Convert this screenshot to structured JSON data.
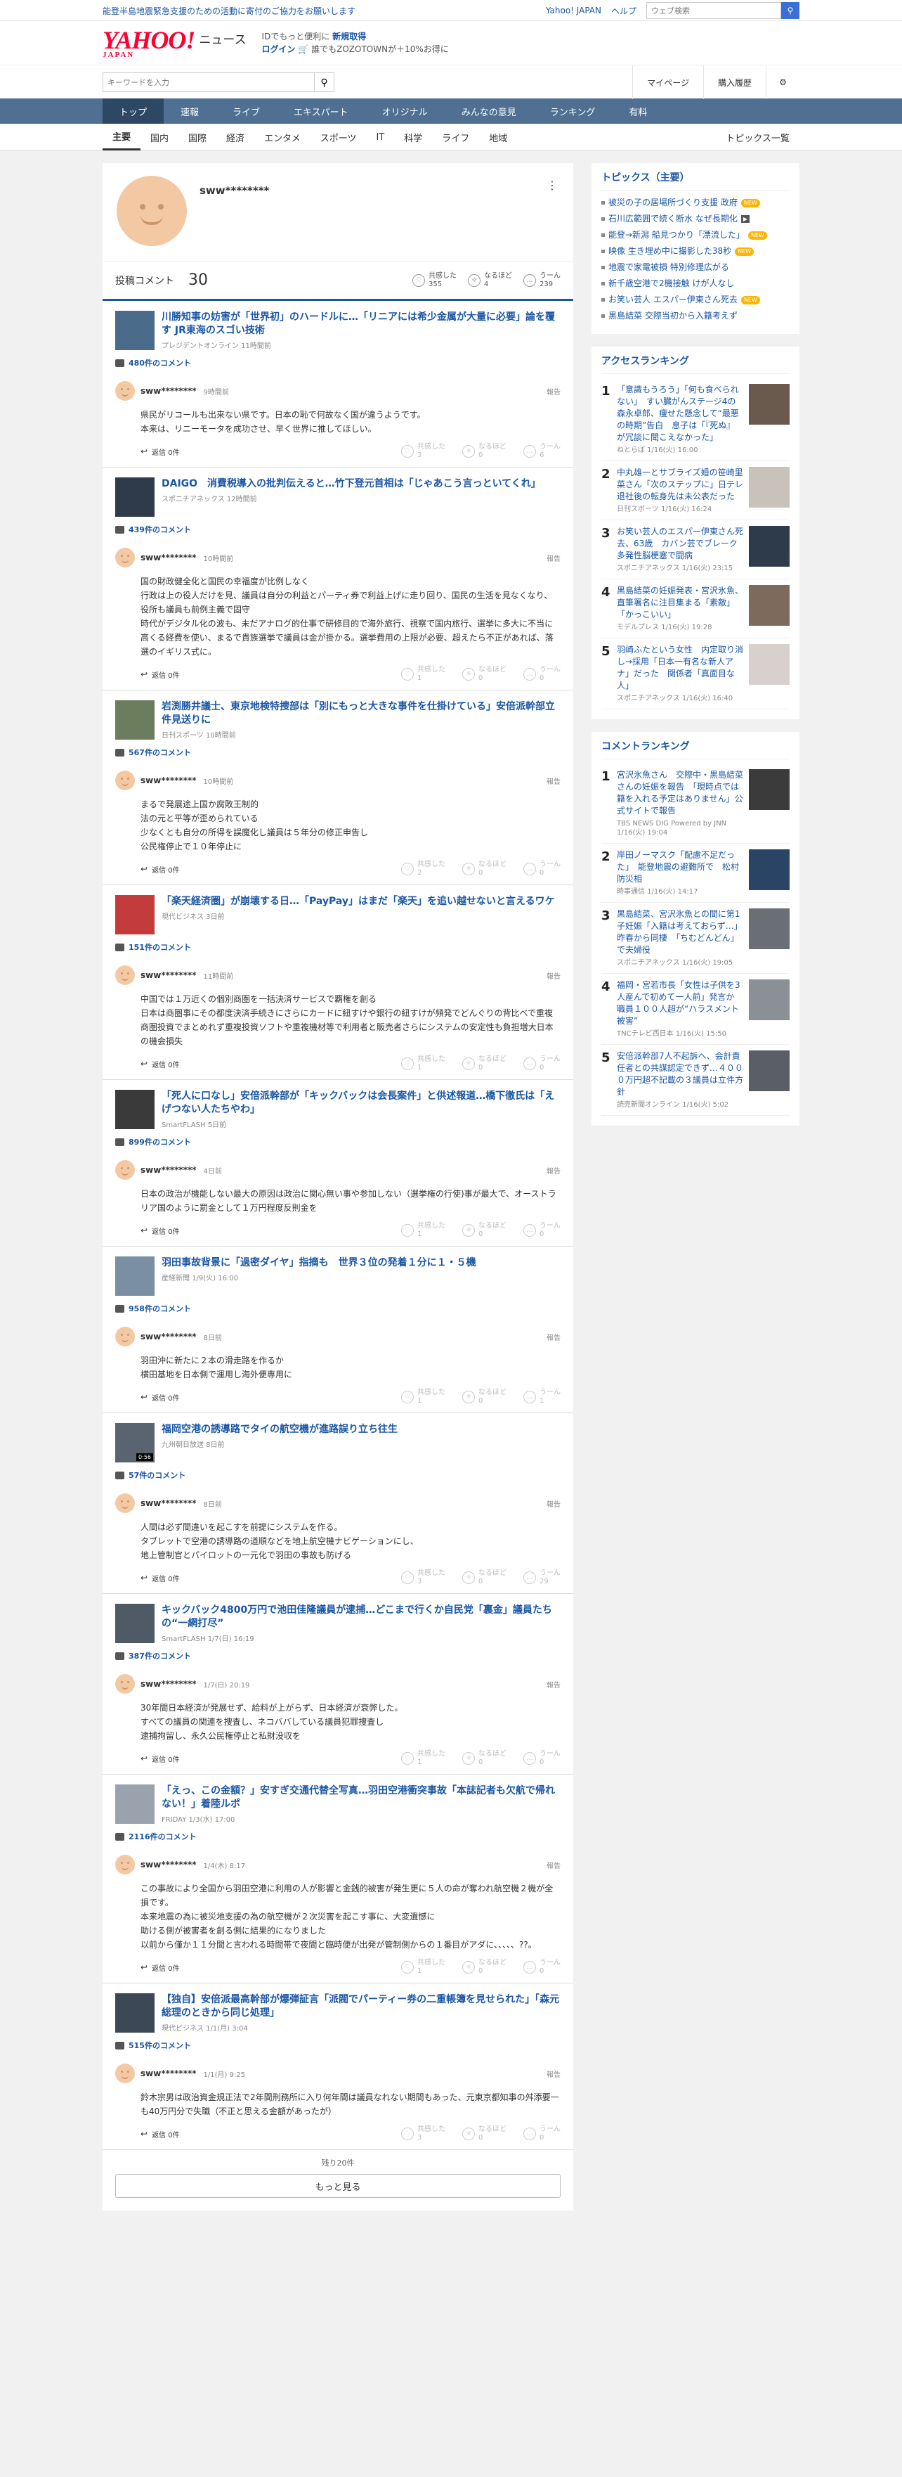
{
  "notice": "能登半島地震緊急支援のための活動に寄付のご協力をお願いします",
  "toplinks": {
    "yahoo": "Yahoo! JAPAN",
    "help": "ヘルプ",
    "web_search_placeholder": "ウェブ検索"
  },
  "brand": {
    "logo": "YAHOO!",
    "logo_sub": "JAPAN",
    "service": "ニュース",
    "promo_line1_a": "IDでもっと便利に",
    "promo_line1_b": "新規取得",
    "promo_line2_a": "ログイン",
    "promo_line2_b": "誰でもZOZOTOWNが＋10%お得に"
  },
  "search": {
    "placeholder": "キーワードを入力",
    "mypage": "マイページ",
    "history": "購入履歴"
  },
  "gnav": [
    "トップ",
    "速報",
    "ライブ",
    "エキスパート",
    "オリジナル",
    "みんなの意見",
    "ランキング",
    "有料"
  ],
  "subnav": [
    "主要",
    "国内",
    "国際",
    "経済",
    "エンタメ",
    "スポーツ",
    "IT",
    "科学",
    "ライフ",
    "地域"
  ],
  "subnav_topics": "トピックス一覧",
  "profile": {
    "username": "sww********",
    "posts_label": "投稿コメント",
    "posts_count": "30",
    "r1_label": "共感した",
    "r1_val": "355",
    "r2_label": "なるほど",
    "r2_val": "4",
    "r3_label": "うーん",
    "r3_val": "239"
  },
  "ui": {
    "reply": "返信 0件",
    "report": "報告",
    "empathy": "共感した",
    "naruhodo": "なるほど",
    "uun": "うーん",
    "remaining": "残り20件",
    "more": "もっと見る"
  },
  "items": [
    {
      "title": "川勝知事の妨害が「世界初」のハードルに…「リニアには希少金属が大量に必要」論を覆す JR東海のスゴい技術",
      "src": "プレジデントオンライン 11時間前",
      "count": "480件のコメント",
      "time": "9時間前",
      "text": "県民がリコールも出来ない県です。日本の恥で何故なく国が違うようです。\n本来は、リニーモータを成功させ、早く世界に推してほしい。",
      "r1": "3",
      "r2": "0",
      "r3": "6"
    },
    {
      "title": "DAIGO　消費税導入の批判伝えると…竹下登元首相は「じゃあこう言っといてくれ」",
      "src": "スポニチアネックス 12時間前",
      "count": "439件のコメント",
      "time": "10時間前",
      "text": "国の財政健全化と国民の幸福度が比例しなく\n行政は上の役人だけを見、議員は自分の利益とパーティ券で利益上げに走り回り、国民の生活を見なくなり、役所も議員も前例主義で固守\n時代がデジタル化の波も、未だアナログ的仕事で研修目的で海外旅行、視察で国内旅行、選挙に多大に不当に高くる経費を使い、まるで貴族選挙で議員は金が掛かる。選挙費用の上限が必要、超えたら不正があれば、落選のイギリス式に。",
      "r1": "1",
      "r2": "0",
      "r3": "0"
    },
    {
      "title": "岩渕勝井議士、東京地検特捜部は「別にもっと大きな事件を仕掛けている」安倍派幹部立件見送りに",
      "src": "日刊スポーツ 10時間前",
      "count": "567件のコメント",
      "time": "10時間前",
      "text": "まるで発展途上国か腐敗王制的\n法の元と平等が歪められている\n少なくとも自分の所得を誤魔化し議員は５年分の修正申告し\n公民権停止で１０年停止に",
      "r1": "2",
      "r2": "0",
      "r3": "0"
    },
    {
      "title": "「楽天経済圏」が崩壊する日…「PayPay」はまだ「楽天」を追い越せないと言えるワケ",
      "src": "現代ビジネス 3日前",
      "count": "151件のコメント",
      "time": "11時間前",
      "text": "中国では１万近くの個別商圏を一括決済サービスで覇権を創る\n日本は商圏事にその都度決済手続きにさらにカードに紐すけや銀行の紐すけが頻発でどんぐりの背比べで重複商圏投資でまとめれず重複投資ソフトや重複機材等で利用者と販売者さらにシステムの安定性も負担増大日本の機会損失",
      "r1": "1",
      "r2": "0",
      "r3": "0"
    },
    {
      "title": "「死人に口なし」安倍派幹部が「キックバックは会長案件」と供述報道…橋下徹氏は「えげつない人たちやわ」",
      "src": "SmartFLASH 5日前",
      "count": "899件のコメント",
      "time": "4日前",
      "text": "日本の政治が機能しない最大の原因は政治に関心無い事や参加しない（選挙権の行使)事が最大で、オーストラリア国のように罰金として１万円程度反則金を",
      "r1": "1",
      "r2": "0",
      "r3": "0"
    },
    {
      "title": "羽田事故背景に「過密ダイヤ」指摘も　世界３位の発着１分に１・５機",
      "src": "産経新聞 1/9(火) 16:00",
      "count": "958件のコメント",
      "time": "8日前",
      "text": "羽田沖に新たに２本の滑走路を作るか\n横田基地を日本側で運用し海外便専用に",
      "r1": "1",
      "r2": "0",
      "r3": "1"
    },
    {
      "title": "福岡空港の誘導路でタイの航空機が進路誤り立ち往生",
      "src": "九州朝日放送 8日前",
      "count": "57件のコメント",
      "time": "8日前",
      "video": "0:56",
      "text": "人間は必ず間違いを起こすを前提にシステムを作る。\nタブレットで空港の誘導路の道順などを地上航空機ナビゲーションにし、\n地上管制官とパイロットの一元化で羽田の事故も防げる",
      "r1": "3",
      "r2": "0",
      "r3": "29"
    },
    {
      "title": "キックバック4800万円で池田佳隆議員が逮捕…どこまで行くか自民党「裏金」議員たちの“一網打尽”",
      "src": "SmartFLASH 1/7(日) 16:19",
      "count": "387件のコメント",
      "time": "1/7(日) 20:19",
      "text": "30年間日本経済が発展せず、給料が上がらず、日本経済が衰弊した。\nすべての議員の関連を捜査し、ネコババしている議員犯罪捜査し\n逮捕拘留し、永久公民権停止と私財没収を",
      "r1": "1",
      "r2": "0",
      "r3": "0"
    },
    {
      "title": "「えっ、この金額？」安すぎ交通代替全写真…羽田空港衝突事故「本誌記者も欠航で帰れない！」着陸ルポ",
      "src": "FRIDAY 1/3(水) 17:00",
      "count": "2116件のコメント",
      "time": "1/4(木) 8:17",
      "text": "この事故により全国から羽田空港に利用の人が影響と金銭的被害が発生更に５人の命が奪われ航空機２機が全損です。\n本来地震の為に被災地支援の為の航空機が２次災害を起こす事に、大変遺憾に\n助ける側が被害者を創る側に結果的になりました\n以前から僅か１１分間と言われる時間帯で夜間と臨時便が出発が管制側からの１番目がアダに、、、、、??。",
      "r1": "1",
      "r2": "0",
      "r3": "0"
    },
    {
      "title": "【独自】安倍派最高幹部が爆弾証言「派閥でパーティー券の二重帳簿を見せられた」「森元総理のときから同じ処理」",
      "src": "現代ビジネス 1/1(月) 3:04",
      "count": "515件のコメント",
      "time": "1/1(月) 9:25",
      "text": "鈴木宗男は政治資金規正法で2年間刑務所に入り何年間は議員なれない期間もあった、元東京都知事の舛添要一も40万円分で失職（不正と思える金額があったが）",
      "r1": "3",
      "r2": "0",
      "r3": "0"
    }
  ],
  "topics": {
    "title": "トピックス（主要）",
    "items": [
      {
        "t": "被災の子の居場所づくり支援 政府",
        "b": "NEW"
      },
      {
        "t": "石川広範囲で続く断水 なぜ長期化",
        "b": "▶"
      },
      {
        "t": "能登→新潟 船見つかり「漂流した」",
        "b": "NEW"
      },
      {
        "t": "映像 生き埋め中に撮影した38秒",
        "b": "NEW"
      },
      {
        "t": "地震で家電被損 特別修理広がる",
        "b": ""
      },
      {
        "t": "新千歳空港で2機接触 けが人なし",
        "b": ""
      },
      {
        "t": "お笑い芸人 エスパー伊東さん死去",
        "b": "NEW"
      },
      {
        "t": "黒島結菜 交際当初から入籍考えず",
        "b": ""
      }
    ]
  },
  "access": {
    "title": "アクセスランキング",
    "items": [
      {
        "n": "1",
        "t": "「意識もうろう」「何も食べられない」　すい臓がんステージ4の森永卓郎、痩せた懸念して“最悪の時期”告白　息子は「『死ぬ』が冗談に聞こえなかった」",
        "s": "ねとらぼ 1/16(火) 16:00"
      },
      {
        "n": "2",
        "t": "中丸雄一とサブライズ婚の笹崎里菜さん「次のステップに」日テレ退社後の転身先は未公表だった",
        "s": "日刊スポーツ 1/16(火) 16:24"
      },
      {
        "n": "3",
        "t": "お笑い芸人のエスパー伊東さん死去、63歳　カバン芸でブレーク　多発性脳梗塞で闘病",
        "s": "スポニチアネックス 1/16(火) 23:15"
      },
      {
        "n": "4",
        "t": "黒島結菜の妊娠発表・宮沢氷魚、直筆署名に注目集まる「素敵」「かっこいい」",
        "s": "モデルプレス 1/16(火) 19:28"
      },
      {
        "n": "5",
        "t": "羽崎ふたという女性　内定取り消し→採用「日本一有名な新人アナ」だった　関係者「真面目な人」",
        "s": "スポニチアネックス 1/16(火) 16:40"
      }
    ]
  },
  "commentrank": {
    "title": "コメントランキング",
    "items": [
      {
        "n": "1",
        "t": "宮沢氷魚さん　交際中・黒島結菜さんの妊娠を報告　「現時点では籍を入れる予定はありません」公式サイトで報告",
        "s": "TBS NEWS DIG Powered by JNN 1/16(火) 19:04"
      },
      {
        "n": "2",
        "t": "岸田ノーマスク「配慮不足だった」　能登地震の避難所で　松村防災相",
        "s": "時事通信 1/16(火) 14:17"
      },
      {
        "n": "3",
        "t": "黒島結菜、宮沢氷魚との間に第1子妊娠「入籍は考えておらず…」昨春から同棲　「ちむどんどん」で夫婦役",
        "s": "スポニチアネックス 1/16(火) 19:05"
      },
      {
        "n": "4",
        "t": "福岡・宮若市長「女性は子供を3人産んで初めて一人前」発言か　職員１００人超が“ハラスメント被害”",
        "s": "TNCテレビ西日本 1/16(火) 15:50"
      },
      {
        "n": "5",
        "t": "安倍派幹部7人不起訴へ、会計責任者との共謀認定できず…４０００万円超不記載の３議員は立件方針",
        "s": "読売新聞オンライン 1/16(火) 5:02"
      }
    ]
  },
  "colors": {
    "link": "#1a56a5",
    "nav": "#4f6f93",
    "nav_active": "#2c4865",
    "brand_red": "#ff0033",
    "avatar": "#f3c9a3"
  }
}
